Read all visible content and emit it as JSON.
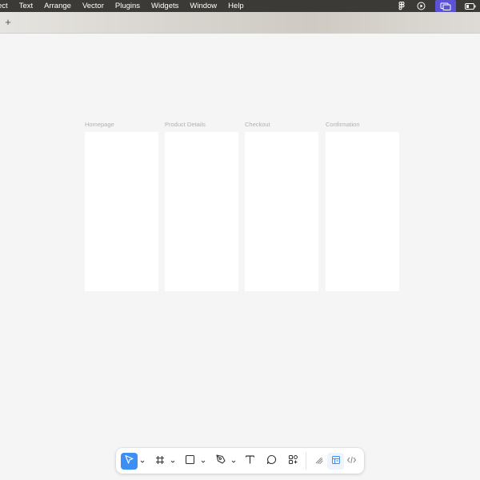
{
  "menubar": {
    "items": [
      "ect",
      "Text",
      "Arrange",
      "Vector",
      "Plugins",
      "Widgets",
      "Window",
      "Help"
    ],
    "right_icons": [
      "figma-icon",
      "play-icon",
      "screen-share-icon",
      "battery-icon"
    ]
  },
  "tabstrip": {
    "new_tab_label": "+"
  },
  "canvas": {
    "frames": [
      {
        "label": "Homepage"
      },
      {
        "label": "Product Details"
      },
      {
        "label": "Checkout"
      },
      {
        "label": "Confirmation"
      }
    ]
  },
  "toolbar": {
    "tools": [
      {
        "name": "move-tool",
        "icon": "cursor-arrow-icon",
        "selected": true
      },
      {
        "name": "frame-tool",
        "icon": "hash-frame-icon"
      },
      {
        "name": "shape-tool",
        "icon": "rectangle-icon"
      },
      {
        "name": "pen-tool",
        "icon": "pen-icon"
      },
      {
        "name": "text-tool",
        "icon": "text-t-icon"
      },
      {
        "name": "comment-tool",
        "icon": "comment-bubble-icon"
      },
      {
        "name": "actions-tool",
        "icon": "actions-grid-icon"
      },
      {
        "name": "draw-mode",
        "icon": "draw-mode-icon"
      },
      {
        "name": "design-mode",
        "icon": "design-mode-icon",
        "active": true
      },
      {
        "name": "dev-mode",
        "icon": "dev-mode-code-icon"
      }
    ]
  },
  "colors": {
    "accent": "#3d8ef5",
    "menubar_bg": "#3b3a36",
    "menubar_active": "#5b52d6",
    "canvas_bg": "#f5f5f5",
    "frame_bg": "#ffffff"
  }
}
